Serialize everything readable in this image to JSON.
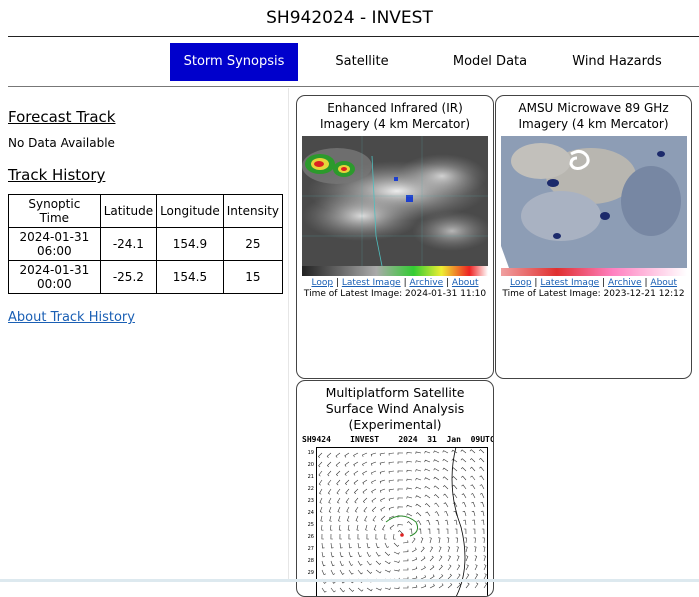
{
  "page_title": "SH942024 - INVEST",
  "nav": {
    "tabs": [
      {
        "label": "Storm Synopsis",
        "active": true
      },
      {
        "label": "Satellite",
        "active": false
      },
      {
        "label": "Model Data",
        "active": false
      },
      {
        "label": "Wind Hazards",
        "active": false
      }
    ]
  },
  "forecast_track": {
    "heading": "Forecast Track",
    "message": "No Data Available"
  },
  "track_history": {
    "heading": "Track History",
    "columns": [
      "Synoptic Time",
      "Latitude",
      "Longitude",
      "Intensity"
    ],
    "rows": [
      [
        "2024-01-31 06:00",
        "-24.1",
        "154.9",
        "25"
      ],
      [
        "2024-01-31 00:00",
        "-25.2",
        "154.5",
        "15"
      ]
    ],
    "about_link": "About Track History"
  },
  "cards": {
    "ir": {
      "title": "Enhanced Infrared (IR) Imagery (4 km Mercator)",
      "links": [
        "Loop",
        "Latest Image",
        "Archive",
        "About"
      ],
      "time": "Time of Latest Image: 2024-01-31 11:10"
    },
    "mw": {
      "title": "AMSU Microwave 89 GHz Imagery (4 km Mercator)",
      "links": [
        "Loop",
        "Latest Image",
        "Archive",
        "About"
      ],
      "time": "Time of Latest Image: 2023-12-21 12:12"
    },
    "wind": {
      "title": "Multiplatform Satellite Surface Wind Analysis (Experimental)",
      "plot_header": "SH9424    INVEST    2024  31  Jan  09UTC",
      "y_ticks": [
        "19",
        "20",
        "21",
        "22",
        "23",
        "24",
        "25",
        "26",
        "27",
        "28",
        "29"
      ]
    }
  },
  "colors": {
    "accent": "#0000cc",
    "link": "#1a5fb4"
  }
}
